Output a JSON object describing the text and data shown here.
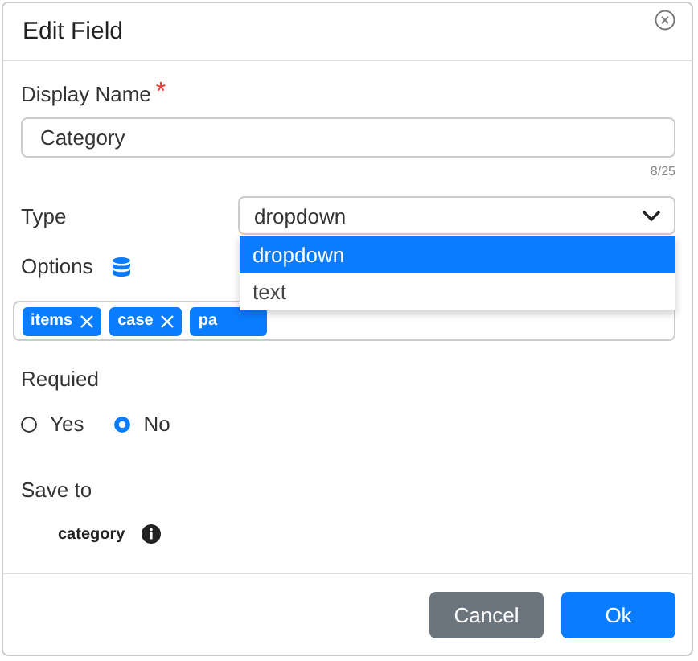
{
  "dialog": {
    "title": "Edit Field"
  },
  "display_name": {
    "label": "Display Name",
    "required_mark": "*",
    "value": "Category",
    "counter": "8/25"
  },
  "type": {
    "label": "Type",
    "value": "dropdown",
    "expanded": true,
    "options": [
      {
        "label": "dropdown",
        "selected": true
      },
      {
        "label": "text",
        "selected": false
      }
    ]
  },
  "options": {
    "label": "Options",
    "tags": [
      {
        "label": "items",
        "removable": true
      },
      {
        "label": "case",
        "removable": true
      },
      {
        "label": "pa",
        "removable": false
      }
    ]
  },
  "required": {
    "label": "Requied",
    "choices": [
      {
        "label": "Yes",
        "selected": false
      },
      {
        "label": "No",
        "selected": true
      }
    ]
  },
  "save_to": {
    "label": "Save to",
    "value": "category"
  },
  "buttons": [
    {
      "label": "Cancel",
      "kind": "secondary"
    },
    {
      "label": "Ok",
      "kind": "primary"
    }
  ]
}
